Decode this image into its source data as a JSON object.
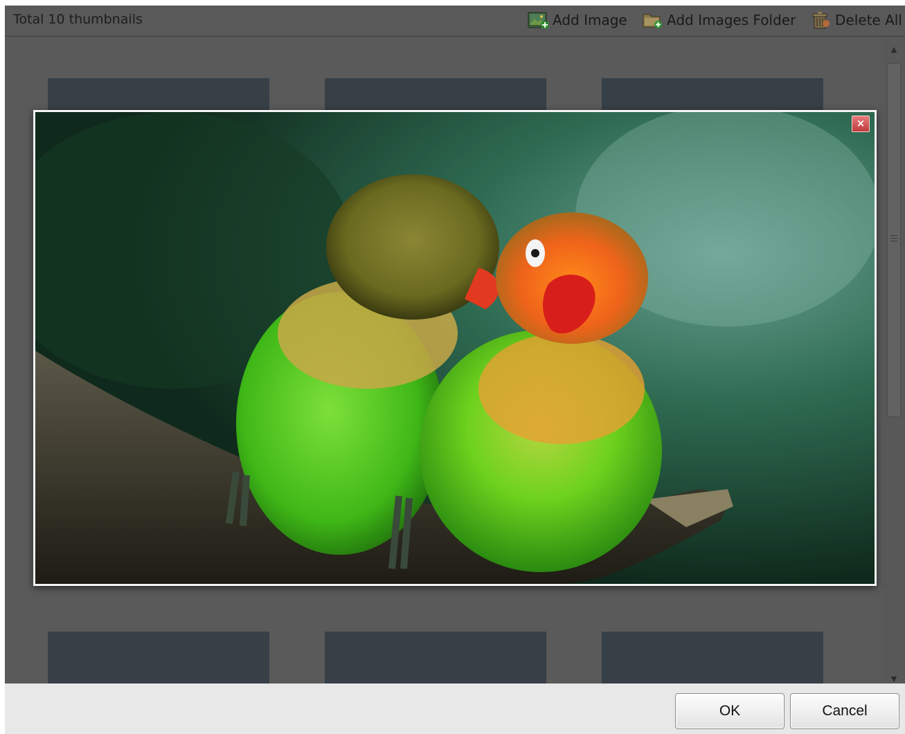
{
  "toolbar": {
    "count_text": "Total 10 thumbnails",
    "add_image_label": "Add Image",
    "add_folder_label": "Add Images Folder",
    "delete_all_label": "Delete All",
    "icons": [
      "image-add-icon",
      "folder-add-icon",
      "delete-all-icon"
    ]
  },
  "lightbox": {
    "close_symbol": "×",
    "image_subject": "two lovebirds on a branch"
  },
  "scrollbar": {
    "up_arrow": "▲",
    "down_arrow": "▼"
  },
  "dialog": {
    "ok_label": "OK",
    "cancel_label": "Cancel"
  },
  "colors": {
    "toolbar_bg": "#595959",
    "gallery_bg": "#5a5a5a",
    "thumb_bg": "#373f47",
    "button_bar_bg": "#e8e8e8",
    "close_button": "#c03a3a"
  }
}
